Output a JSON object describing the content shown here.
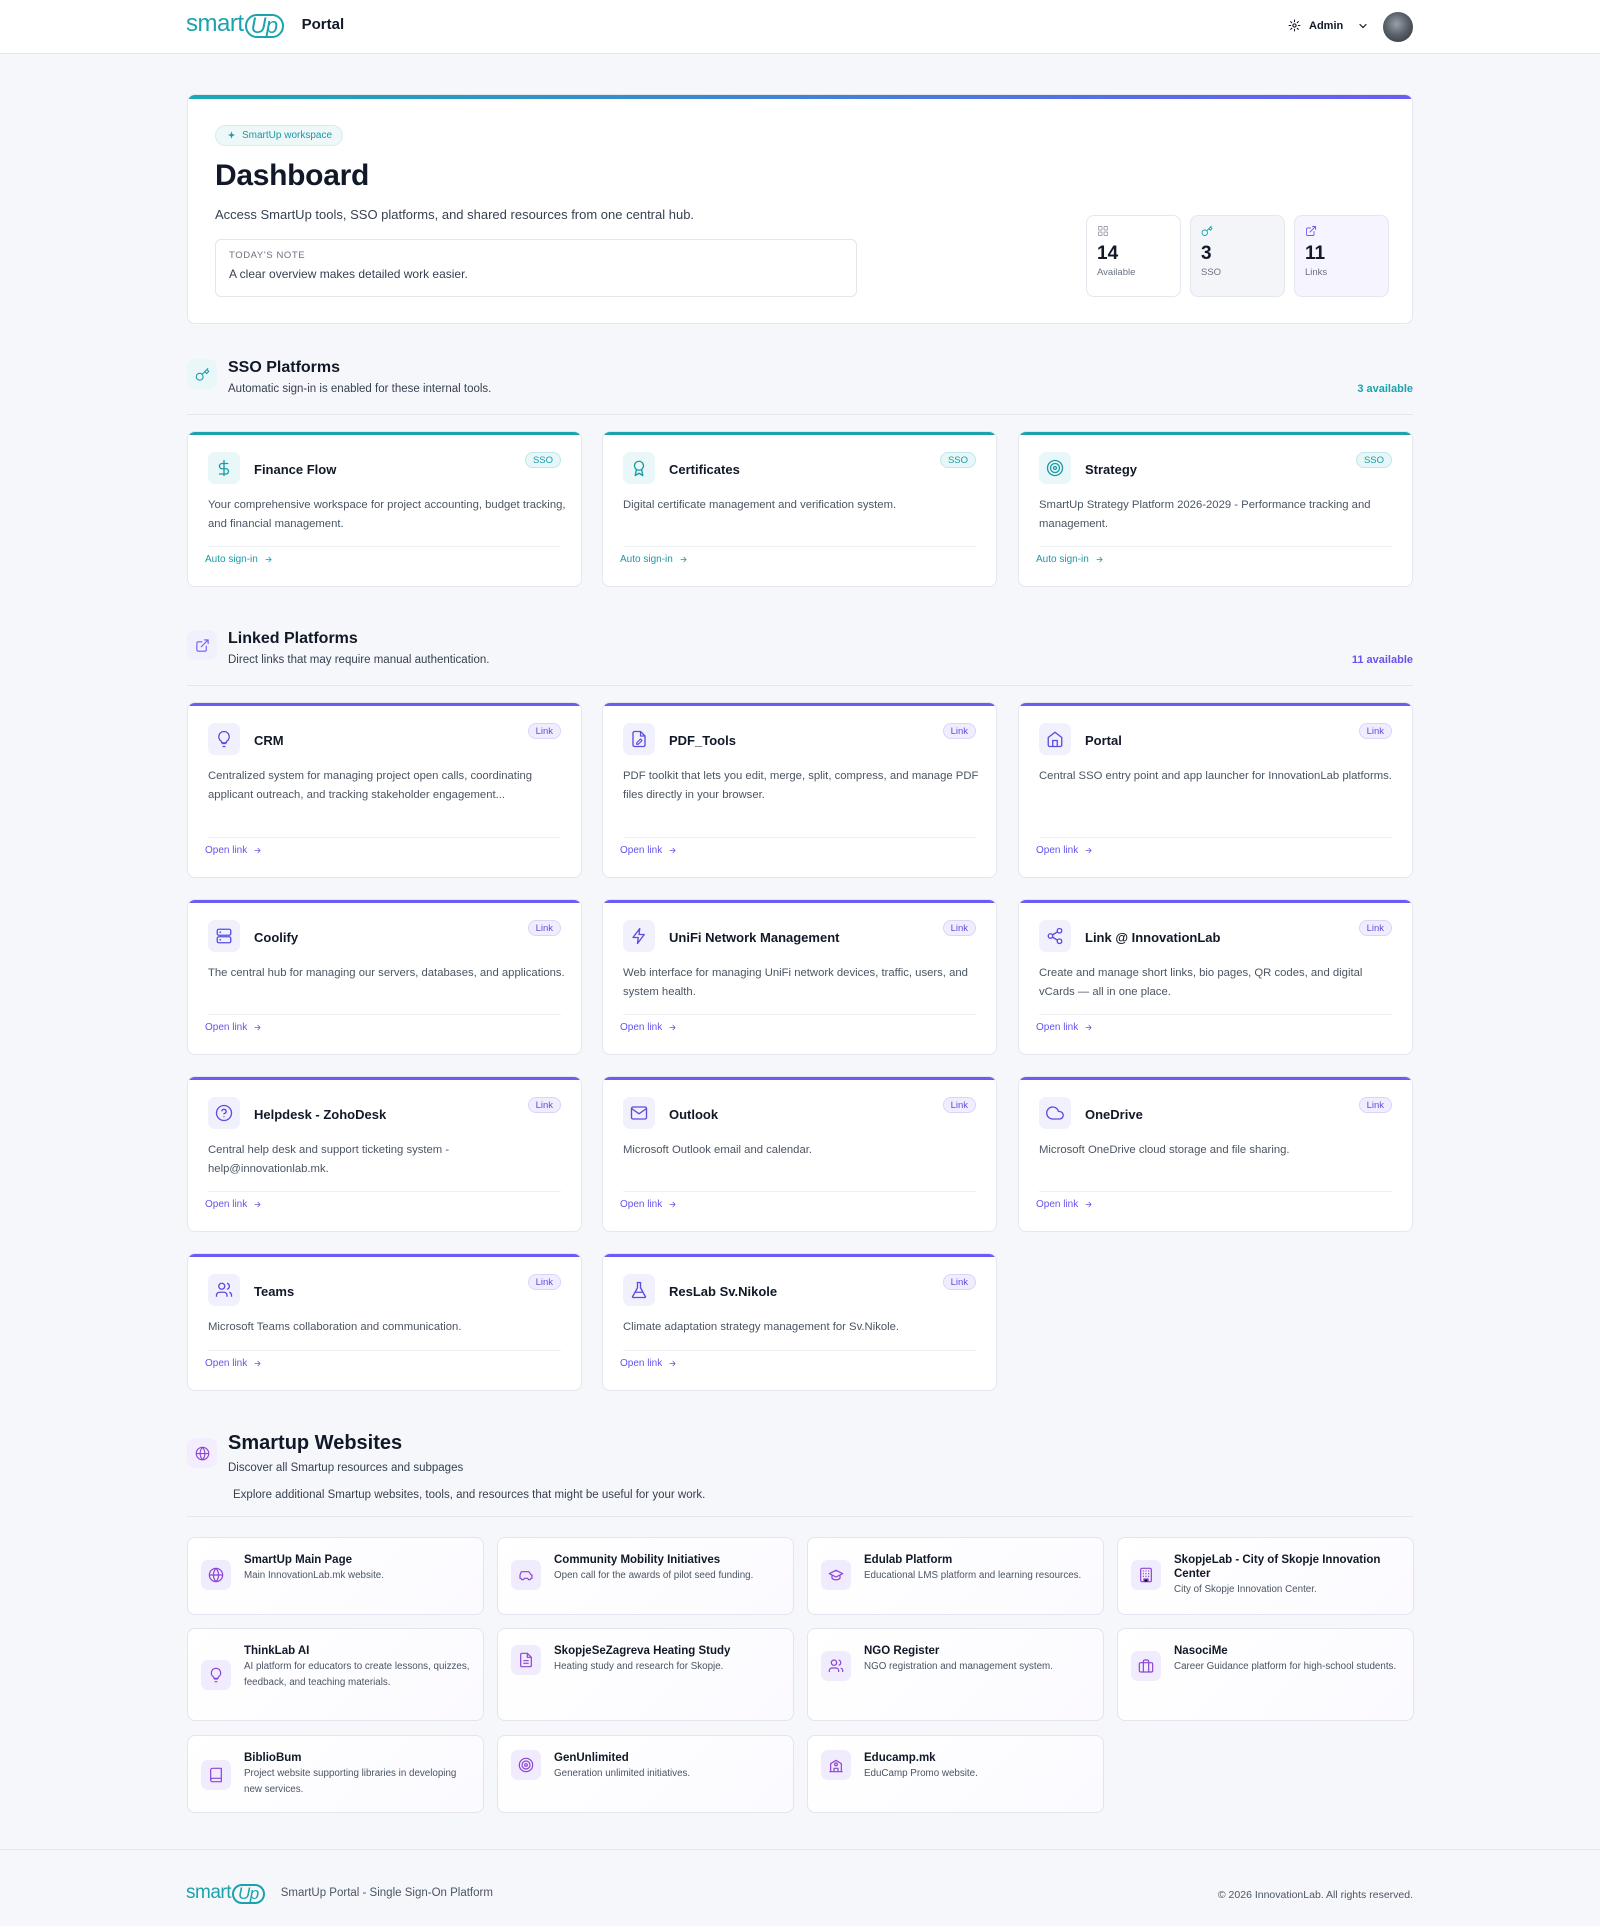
{
  "header": {
    "logo_text": "smart",
    "logo_up": "Up",
    "portal": "Portal",
    "user": "Admin"
  },
  "hero": {
    "chip": "SmartUp workspace",
    "title": "Dashboard",
    "subtitle": "Access SmartUp tools, SSO platforms, and shared resources from one central hub.",
    "note_label": "TODAY'S NOTE",
    "note_text": "A clear overview makes detailed work easier.",
    "stats": [
      {
        "value": "14",
        "label": "Available",
        "icon": "grid-icon"
      },
      {
        "value": "3",
        "label": "SSO",
        "icon": "key-icon"
      },
      {
        "value": "11",
        "label": "Links",
        "icon": "external-link-icon"
      }
    ]
  },
  "sso": {
    "title": "SSO Platforms",
    "subtitle": "Automatic sign-in is enabled for these internal tools.",
    "count": "3 available",
    "cards": [
      {
        "title": "Finance Flow",
        "badge": "SSO",
        "desc": "Your comprehensive workspace for project accounting, budget tracking, and financial management.",
        "action": "Auto sign-in",
        "icon": "dollar-icon"
      },
      {
        "title": "Certificates",
        "badge": "SSO",
        "desc": "Digital certificate management and verification system.",
        "action": "Auto sign-in",
        "icon": "award-icon"
      },
      {
        "title": "Strategy",
        "badge": "SSO",
        "desc": "SmartUp Strategy Platform 2026-2029 - Performance tracking and management.",
        "action": "Auto sign-in",
        "icon": "target-icon"
      }
    ]
  },
  "linked": {
    "title": "Linked Platforms",
    "subtitle": "Direct links that may require manual authentication.",
    "count": "11 available",
    "cards": [
      {
        "title": "CRM",
        "badge": "Link",
        "desc": "Centralized system for managing project open calls, coordinating applicant outreach, and tracking stakeholder engagement...",
        "action": "Open link",
        "icon": "lightbulb-icon"
      },
      {
        "title": "PDF_Tools",
        "badge": "Link",
        "desc": "PDF toolkit that lets you edit, merge, split, compress, and manage PDF files directly in your browser.",
        "action": "Open link",
        "icon": "file-edit-icon"
      },
      {
        "title": "Portal",
        "badge": "Link",
        "desc": "Central SSO entry point and app launcher for InnovationLab platforms.",
        "action": "Open link",
        "icon": "home-icon"
      },
      {
        "title": "Coolify",
        "badge": "Link",
        "desc": "The central hub for managing our servers, databases, and applications.",
        "action": "Open link",
        "icon": "server-icon"
      },
      {
        "title": "UniFi Network Management",
        "badge": "Link",
        "desc": "Web interface for managing UniFi network devices, traffic, users, and system health.",
        "action": "Open link",
        "icon": "bolt-icon"
      },
      {
        "title": "Link @ InnovationLab",
        "badge": "Link",
        "desc": "Create and manage short links, bio pages, QR codes, and digital vCards — all in one place.",
        "action": "Open link",
        "icon": "share-icon"
      },
      {
        "title": "Helpdesk - ZohoDesk",
        "badge": "Link",
        "desc": "Central help desk and support ticketing system - help@innovationlab.mk.",
        "action": "Open link",
        "icon": "help-circle-icon"
      },
      {
        "title": "Outlook",
        "badge": "Link",
        "desc": "Microsoft Outlook email and calendar.",
        "action": "Open link",
        "icon": "mail-icon"
      },
      {
        "title": "OneDrive",
        "badge": "Link",
        "desc": "Microsoft OneDrive cloud storage and file sharing.",
        "action": "Open link",
        "icon": "cloud-icon"
      },
      {
        "title": "Teams",
        "badge": "Link",
        "desc": "Microsoft Teams collaboration and communication.",
        "action": "Open link",
        "icon": "users-icon"
      },
      {
        "title": "ResLab Sv.Nikole",
        "badge": "Link",
        "desc": "Climate adaptation strategy management for Sv.Nikole.",
        "action": "Open link",
        "icon": "flask-icon"
      }
    ]
  },
  "websites": {
    "title": "Smartup Websites",
    "subtitle": "Discover all Smartup resources and subpages",
    "explore": "Explore additional Smartup websites, tools, and resources that might be useful for your work.",
    "items": [
      {
        "title": "SmartUp Main Page",
        "desc": "Main InnovationLab.mk website.",
        "icon": "globe-icon"
      },
      {
        "title": "Community Mobility Initiatives",
        "desc": "Open call for the awards of pilot seed funding.",
        "icon": "car-icon"
      },
      {
        "title": "Edulab Platform",
        "desc": "Educational LMS platform and learning resources.",
        "icon": "graduation-cap-icon"
      },
      {
        "title": "SkopjeLab - City of Skopje Innovation Center",
        "desc": "City of Skopje Innovation Center.",
        "icon": "building-icon"
      },
      {
        "title": "ThinkLab AI",
        "desc": "AI platform for educators to create lessons, quizzes, feedback, and teaching materials.",
        "icon": "lightbulb-icon"
      },
      {
        "title": "SkopjeSeZagreva Heating Study",
        "desc": "Heating study and research for Skopje.",
        "icon": "document-icon"
      },
      {
        "title": "NGO Register",
        "desc": "NGO registration and management system.",
        "icon": "users-icon"
      },
      {
        "title": "NasociMe",
        "desc": "Career Guidance platform for high-school students.",
        "icon": "briefcase-icon"
      },
      {
        "title": "BiblioBum",
        "desc": "Project website supporting libraries in developing new services.",
        "icon": "book-icon"
      },
      {
        "title": "GenUnlimited",
        "desc": "Generation unlimited initiatives.",
        "icon": "target-icon"
      },
      {
        "title": "Educamp.mk",
        "desc": "EduCamp Promo website.",
        "icon": "school-icon"
      }
    ]
  },
  "footer": {
    "text": "SmartUp Portal - Single Sign-On Platform",
    "copyright": "© 2026 InnovationLab. All rights reserved."
  },
  "colors": {
    "teal": "#1aa3ad",
    "purple": "#6b5cf6",
    "violet": "#8b45d6"
  }
}
